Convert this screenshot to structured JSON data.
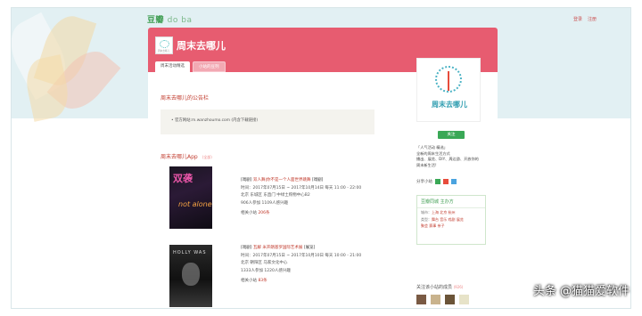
{
  "topbar": {
    "logo_main": "豆瓣",
    "logo_sub": "do ba",
    "login": "登录",
    "register": "注册"
  },
  "site": {
    "title": "周末去哪儿",
    "avatar_caption": "周末去哪儿",
    "tabs": [
      "周末活动精选",
      "小站的豆列"
    ]
  },
  "board": {
    "title": "周末去哪儿的公告栏",
    "notice": "• 官方网站:m.wanzhoumo.com  (内含下载链接)"
  },
  "app_section": {
    "title": "周末去哪儿App",
    "more": "(全部)"
  },
  "events": [
    {
      "poster_title": "双袭",
      "poster_sub": "not alone",
      "tag": "[戏剧]",
      "name": "双人舞",
      "name_rest": "|你不是一个人面世界跳舞",
      "tag_end": "[戏剧]",
      "time": "时间：2017年07月15日 ~ 2017年10月14日 每天 11:00 - 22:00",
      "place": "北京 东城区 东直门 中绿土购物中心B2",
      "people": "906人参加  1109人感兴趣",
      "related": "相关小站",
      "count": "206条"
    },
    {
      "poster_title": "HOLLY WAS",
      "tag": "[戏剧]",
      "name": "瓦解",
      "name_rest": "米开朗基罗国际艺术展",
      "tag_end": "[展览]",
      "time": "时间：2017年07月15日 ~ 2017年10月10日 每天 10:00 - 21:00",
      "place": "北京 朝阳区 马家文化中心",
      "people": "1333人参加  1220人感兴趣",
      "related": "相关小站",
      "count": "83条"
    }
  ],
  "sidebar": {
    "brand": "周末去哪儿",
    "follow": "关注",
    "desc_lines": [
      "「人气活动 精选」",
      "全新的周末生活方式",
      "播出、展览、DIY、周边游、开放你的",
      "周末新生活!"
    ],
    "share_label": "分享小站",
    "share_colors": [
      "#3aa856",
      "#e74c3c",
      "#4aa3df"
    ],
    "box_title": "豆瓣同城 主办方",
    "box_lines": [
      {
        "label": "城市：",
        "value": "上海 北京 杭州"
      },
      {
        "label": "类型：",
        "value": "舞台 音乐 戏剧 展览"
      },
      {
        "label": "",
        "value": "聚会 赛事 亲子"
      }
    ],
    "members_title": "关注该小站的成员",
    "members_count": "(926)",
    "avatar_colors": [
      "#7a5a44",
      "#c9b38d",
      "#6b5438",
      "#e7e3c8"
    ]
  },
  "watermark": "头条 @猫猫爱软件"
}
